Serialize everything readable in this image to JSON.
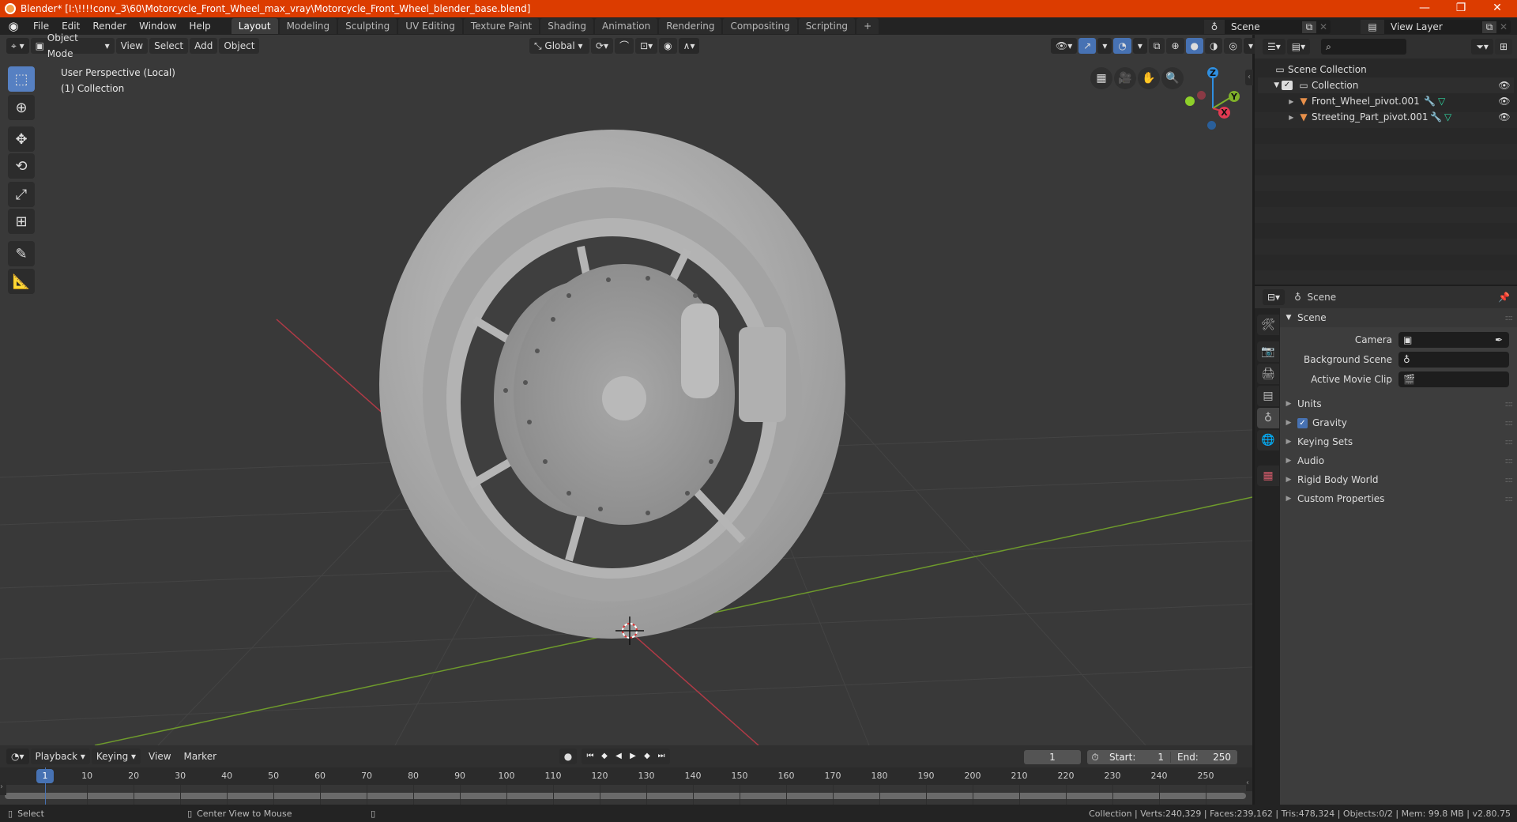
{
  "window": {
    "title": "Blender* [I:\\!!!!conv_3\\60\\Motorcycle_Front_Wheel_max_vray\\Motorcycle_Front_Wheel_blender_base.blend]",
    "minimize": "—",
    "maximize": "❐",
    "close": "✕"
  },
  "menu": [
    "File",
    "Edit",
    "Render",
    "Window",
    "Help"
  ],
  "workspaces": [
    "Layout",
    "Modeling",
    "Sculpting",
    "UV Editing",
    "Texture Paint",
    "Shading",
    "Animation",
    "Rendering",
    "Compositing",
    "Scripting"
  ],
  "active_workspace": "Layout",
  "add_workspace": "+",
  "scene_selector": {
    "value": "Scene"
  },
  "view_layer_selector": {
    "value": "View Layer"
  },
  "viewport_header": {
    "mode": "Object Mode",
    "menus": [
      "View",
      "Select",
      "Add",
      "Object"
    ],
    "orientation": "Global"
  },
  "viewport": {
    "perspective_label": "User Perspective (Local)",
    "collection_label": "(1) Collection",
    "gizmo": {
      "z": "Z",
      "y": "Y",
      "x": "X"
    }
  },
  "outliner": {
    "search_placeholder": "",
    "scene_collection": "Scene Collection",
    "collection": "Collection",
    "objects": [
      {
        "name": "Front_Wheel_pivot.001"
      },
      {
        "name": "Streeting_Part_pivot.001"
      }
    ]
  },
  "properties": {
    "header": "Scene",
    "panel_title": "Scene",
    "fields": [
      {
        "label": "Camera",
        "value": ""
      },
      {
        "label": "Background Scene",
        "value": ""
      },
      {
        "label": "Active Movie Clip",
        "value": ""
      }
    ],
    "sections": [
      {
        "label": "Units",
        "checkbox": false
      },
      {
        "label": "Gravity",
        "checkbox": true
      },
      {
        "label": "Keying Sets",
        "checkbox": false
      },
      {
        "label": "Audio",
        "checkbox": false
      },
      {
        "label": "Rigid Body World",
        "checkbox": false
      },
      {
        "label": "Custom Properties",
        "checkbox": false
      }
    ]
  },
  "timeline": {
    "menus": [
      "Playback",
      "Keying",
      "View",
      "Marker"
    ],
    "current_frame": "1",
    "start_label": "Start:",
    "start": "1",
    "end_label": "End:",
    "end": "250",
    "ticks": [
      "10",
      "20",
      "30",
      "40",
      "50",
      "60",
      "70",
      "80",
      "90",
      "100",
      "110",
      "120",
      "130",
      "140",
      "150",
      "160",
      "170",
      "180",
      "190",
      "200",
      "210",
      "220",
      "230",
      "240",
      "250"
    ],
    "playhead": "1"
  },
  "statusbar": {
    "left_action": "Select",
    "middle_action": "Center View to Mouse",
    "stats": "Collection | Verts:240,329 | Faces:239,162 | Tris:478,324 | Objects:0/2 | Mem: 99.8 MB | v2.80.75"
  },
  "colors": {
    "title_bar": "#dc3c00",
    "accent_blue": "#4772b3",
    "axis_x": "#d63a4a",
    "axis_y": "#7fb02a",
    "axis_z": "#2f8fe0",
    "object_icon": "#e8904a"
  }
}
